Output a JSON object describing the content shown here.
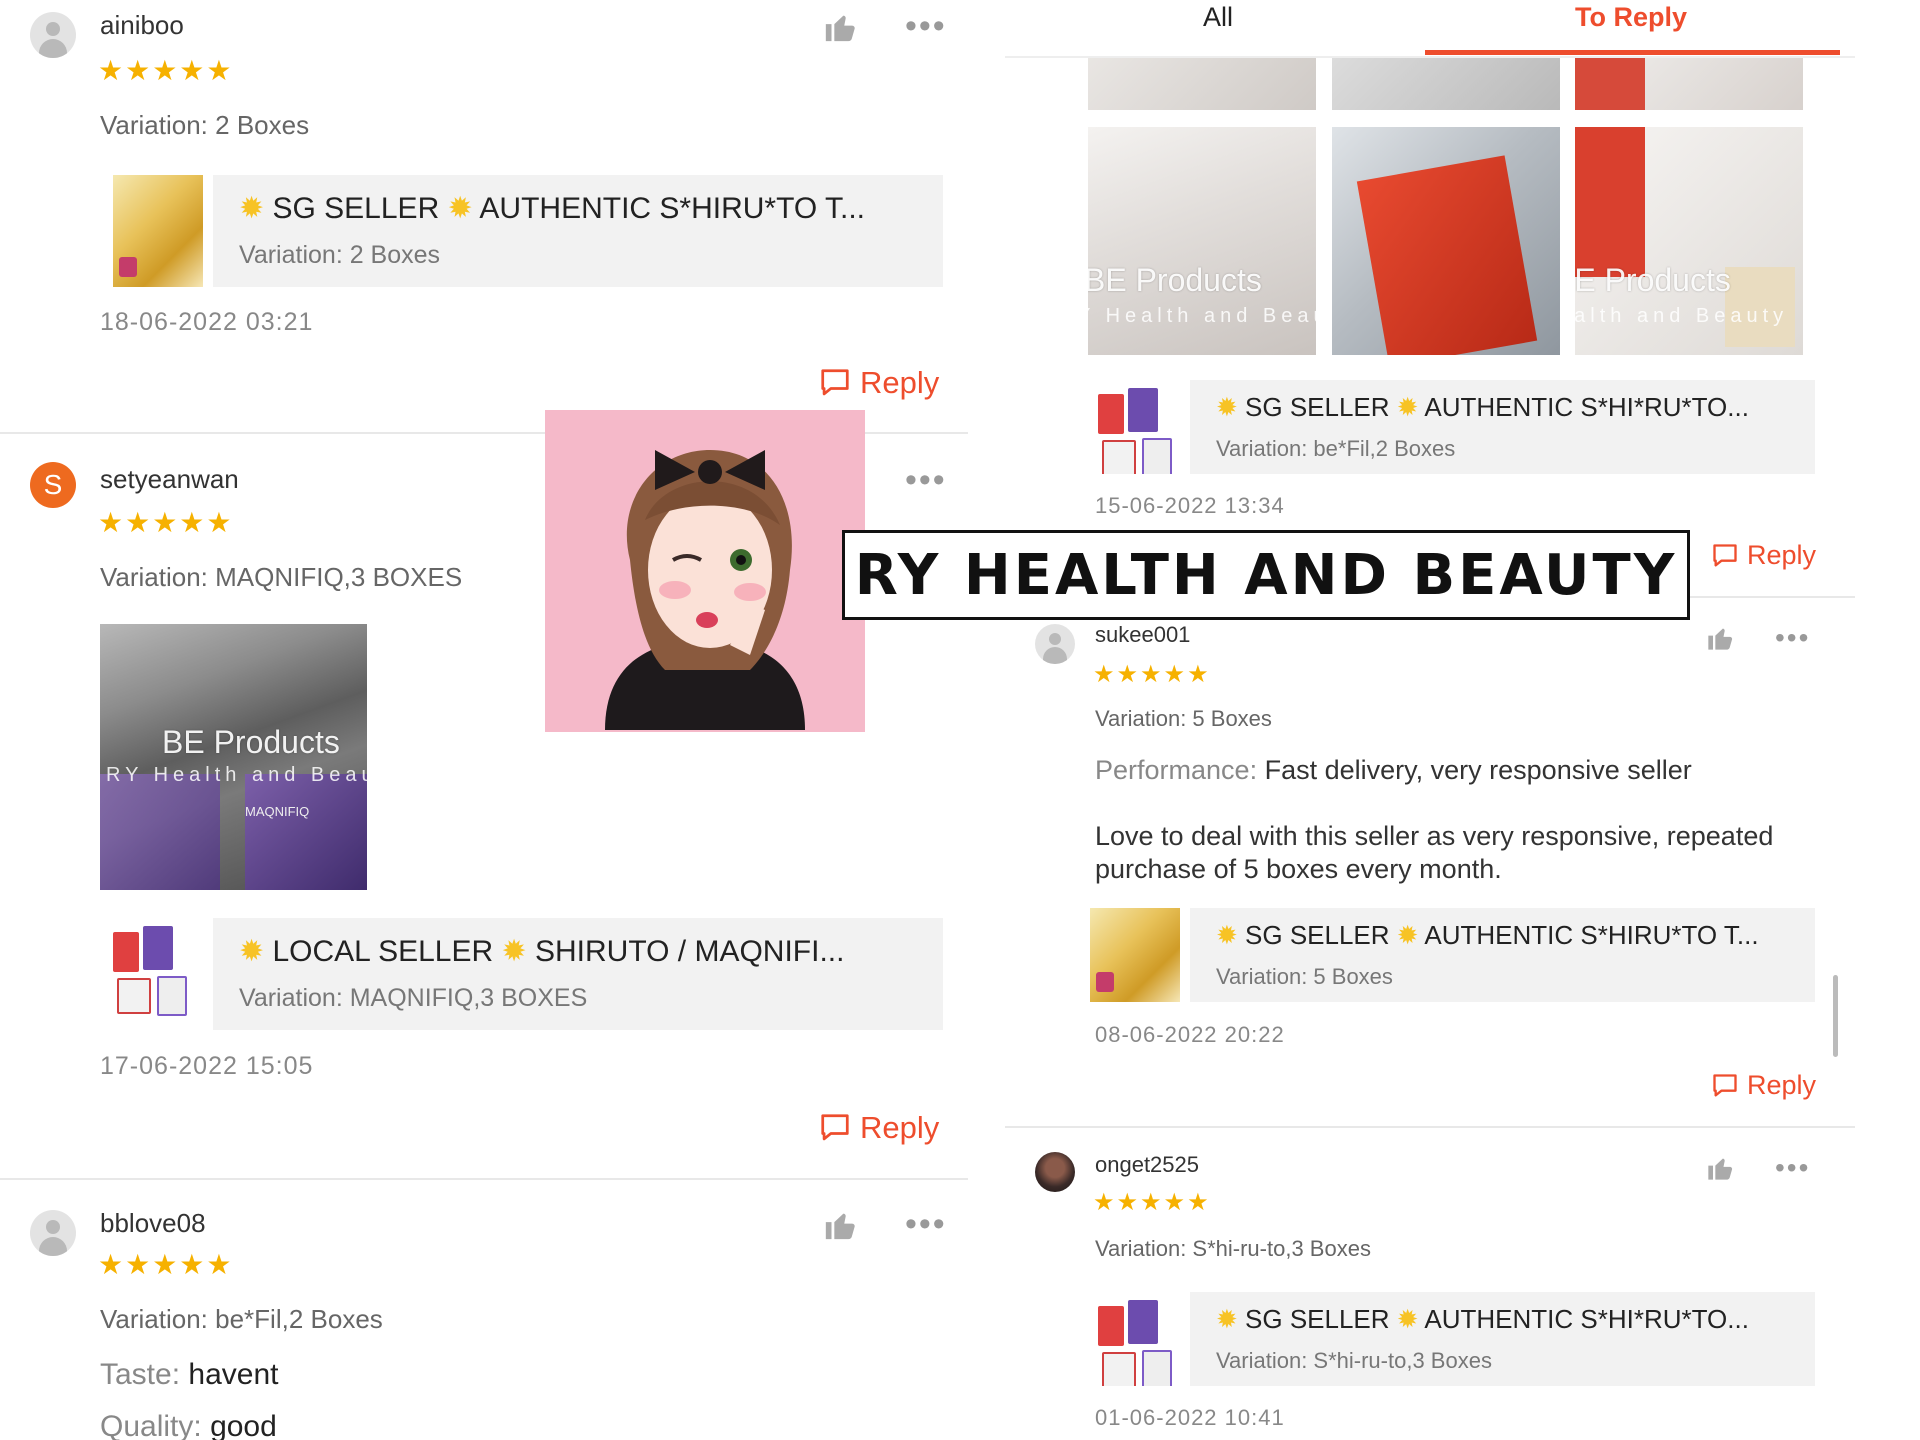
{
  "tabs": {
    "all": "All",
    "to_reply": "To Reply"
  },
  "reply_label": "Reply",
  "watermark": {
    "main": "BE Products",
    "sub": "RY Health and Beauty"
  },
  "banner": {
    "text": "RY HEALTH AND BEAUTY"
  },
  "left_reviews": [
    {
      "username": "ainiboo",
      "avatar": "default-person",
      "rating": 5,
      "stars": "★★★★★",
      "variation": "Variation: 2 Boxes",
      "product": {
        "title": "SG SELLER",
        "title_rest": "AUTHENTIC S*HIRU*TO T...",
        "variation": "Variation: 2 Boxes"
      },
      "date": "18-06-2022 03:21"
    },
    {
      "username": "setyeanwan",
      "avatar_letter": "S",
      "rating": 5,
      "stars": "★★★★★",
      "variation": "Variation: MAQNIFIQ,3 BOXES",
      "photo_label": "MAQNIFIQ",
      "product": {
        "title": "LOCAL SELLER",
        "title_rest": "SHIRUTO / MAQNIFI...",
        "variation": "Variation: MAQNIFIQ,3 BOXES"
      },
      "date": "17-06-2022 15:05"
    },
    {
      "username": "bblove08",
      "avatar": "default-person",
      "rating": 5,
      "stars": "★★★★★",
      "variation": "Variation: be*Fil,2 Boxes",
      "taste_key": "Taste:",
      "taste_val": "havent",
      "quality_key": "Quality:",
      "quality_val": "good"
    }
  ],
  "right_reviews": [
    {
      "product": {
        "title": "SG SELLER",
        "title_rest": "AUTHENTIC S*HI*RU*TO...",
        "variation": "Variation: be*Fil,2 Boxes"
      },
      "date": "15-06-2022 13:34"
    },
    {
      "username": "sukee001",
      "rating": 5,
      "stars": "★★★★★",
      "variation": "Variation: 5 Boxes",
      "performance_key": "Performance:",
      "performance_val": "Fast delivery, very responsive seller",
      "comment": "Love to deal with this seller as very responsive, repeated purchase of 5 boxes every month.",
      "product": {
        "title": "SG SELLER",
        "title_rest": "AUTHENTIC S*HIRU*TO T...",
        "variation": "Variation: 5 Boxes"
      },
      "date": "08-06-2022 20:22"
    },
    {
      "username": "onget2525",
      "rating": 5,
      "stars": "★★★★★",
      "variation": "Variation: S*hi-ru-to,3 Boxes",
      "product": {
        "title": "SG SELLER",
        "title_rest": "AUTHENTIC S*HI*RU*TO...",
        "variation": "Variation: S*hi-ru-to,3 Boxes"
      },
      "date": "01-06-2022 10:41"
    }
  ],
  "colors": {
    "accent": "#ee4d2d",
    "star": "#f6b100",
    "card_bg": "#f2f2f2"
  },
  "icons": [
    "thumbs-up-icon",
    "more-icon",
    "reply-bubble-icon",
    "sparkle-icon",
    "person-icon"
  ]
}
